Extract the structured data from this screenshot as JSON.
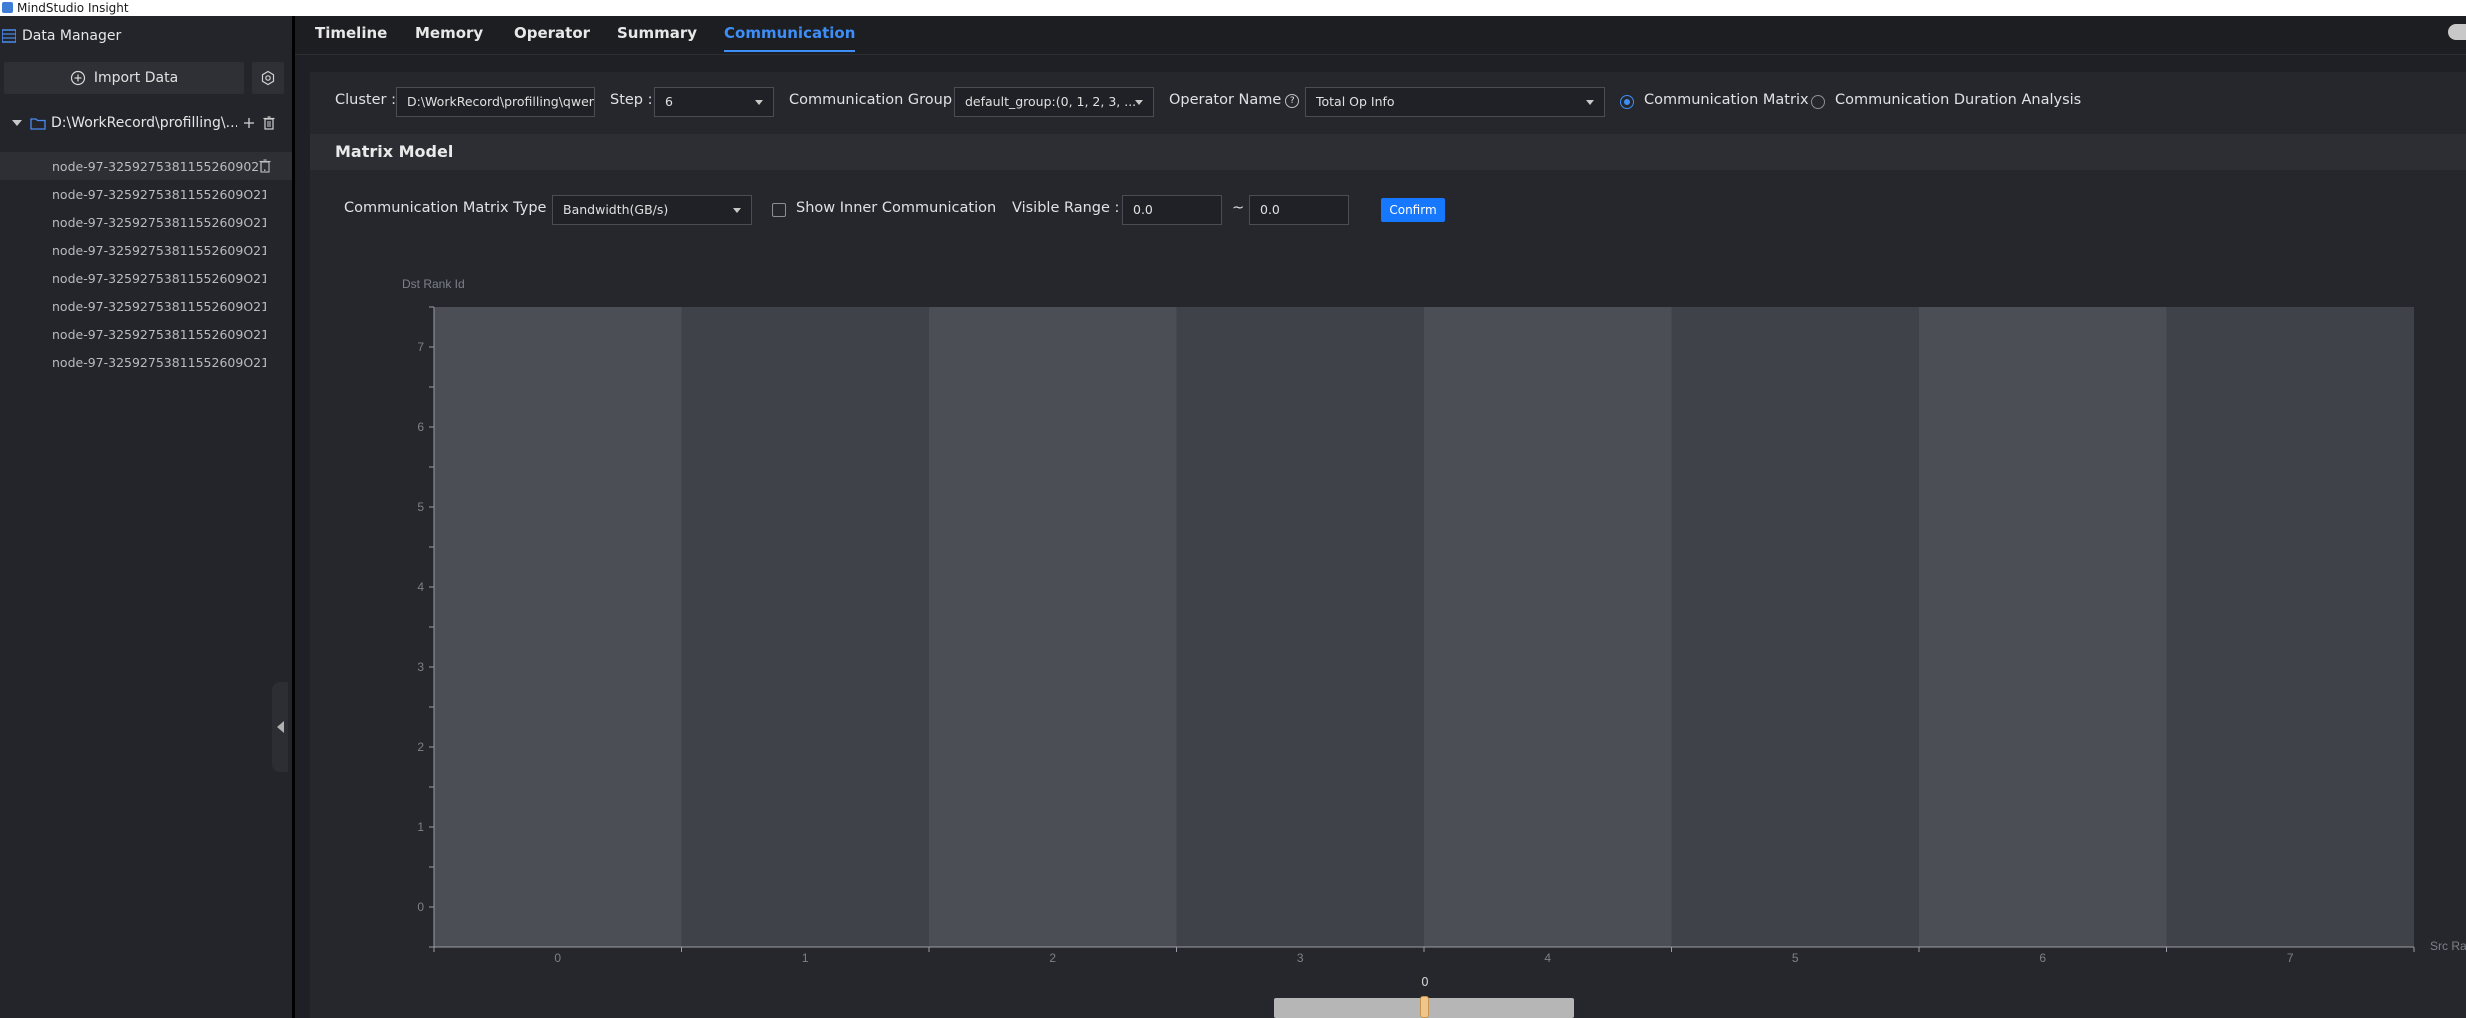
{
  "app": {
    "title": "MindStudio Insight"
  },
  "sidebar": {
    "title": "Data Manager",
    "import_label": "Import Data",
    "root_label": "D:\\WorkRecord\\profilling\\...",
    "nodes": [
      "node-97-3259275381155260902l...",
      "node-97-32592753811552609O212_...",
      "node-97-32592753811552609O212_...",
      "node-97-32592753811552609O212_...",
      "node-97-32592753811552609O212_...",
      "node-97-32592753811552609O212_...",
      "node-97-32592753811552609O212_...",
      "node-97-32592753811552609O212_..."
    ]
  },
  "tabs": [
    {
      "label": "Timeline",
      "active": false
    },
    {
      "label": "Memory",
      "active": false
    },
    {
      "label": "Operator",
      "active": false
    },
    {
      "label": "Summary",
      "active": false
    },
    {
      "label": "Communication",
      "active": true
    }
  ],
  "controls": {
    "cluster_label": "Cluster :",
    "cluster_value": "D:\\WorkRecord\\profilling\\qwen",
    "step_label": "Step :",
    "step_value": "6",
    "group_label": "Communication Group :",
    "group_value": "default_group:(0, 1, 2, 3, ...",
    "operator_label": "Operator Name",
    "operator_value": "Total Op Info",
    "radio_matrix": "Communication Matrix",
    "radio_duration": "Communication Duration Analysis"
  },
  "matrix": {
    "section_title": "Matrix Model",
    "type_label": "Communication Matrix Type :",
    "type_value": "Bandwidth(GB/s)",
    "inner_label": "Show Inner Communication",
    "range_label": "Visible Range :",
    "range_min": "0.0",
    "range_sep": "~",
    "range_max": "0.0",
    "confirm_label": "Confirm"
  },
  "chart_data": {
    "type": "heatmap",
    "xlabel": "Src Rank Id",
    "ylabel": "Dst Rank Id",
    "x_categories": [
      "0",
      "1",
      "2",
      "3",
      "4",
      "5",
      "6",
      "7"
    ],
    "y_categories": [
      "0",
      "1",
      "2",
      "3",
      "4",
      "5",
      "6",
      "7"
    ],
    "values": [],
    "visual_map": {
      "min": 0,
      "value": 0,
      "label": "0"
    },
    "colors": {
      "band_light": "#4b4e54",
      "band_dark": "#3f4248",
      "axis": "#9a9da3",
      "tick_text": "#7d8088"
    }
  }
}
